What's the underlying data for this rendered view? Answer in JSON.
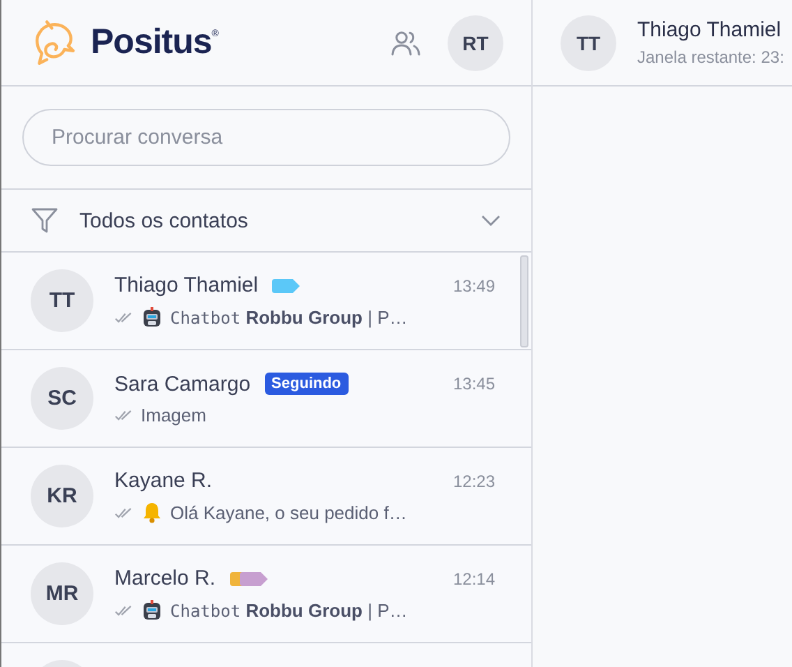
{
  "brand": {
    "name": "Positus",
    "mark": "®"
  },
  "user": {
    "initials": "RT"
  },
  "search": {
    "placeholder": "Procurar conversa"
  },
  "filter": {
    "label": "Todos os contatos"
  },
  "conversations": [
    {
      "initials": "TT",
      "name": "Thiago Thamiel",
      "tags": [
        {
          "color": "#5bc8f8"
        }
      ],
      "time": "13:49",
      "kind": "robot",
      "sender": "Chatbot",
      "text": "**Robbu Group** | P…"
    },
    {
      "initials": "SC",
      "name": "Sara Camargo",
      "badge": "Seguindo",
      "time": "13:45",
      "text": "Imagem"
    },
    {
      "initials": "KR",
      "name": "Kayane R.",
      "time": "12:23",
      "kind": "bell",
      "text": "Olá Kayane, o seu pedido f…"
    },
    {
      "initials": "MR",
      "name": "Marcelo R.",
      "tags": [
        {
          "color": "#f0b43c"
        },
        {
          "color": "#c79fd0"
        }
      ],
      "time": "12:14",
      "kind": "robot",
      "sender": "Chatbot",
      "text": "**Robbu Group** | P…"
    }
  ],
  "chat": {
    "initials": "TT",
    "name": "Thiago Thamiel",
    "subtitle": "Janela restante: 23:"
  }
}
